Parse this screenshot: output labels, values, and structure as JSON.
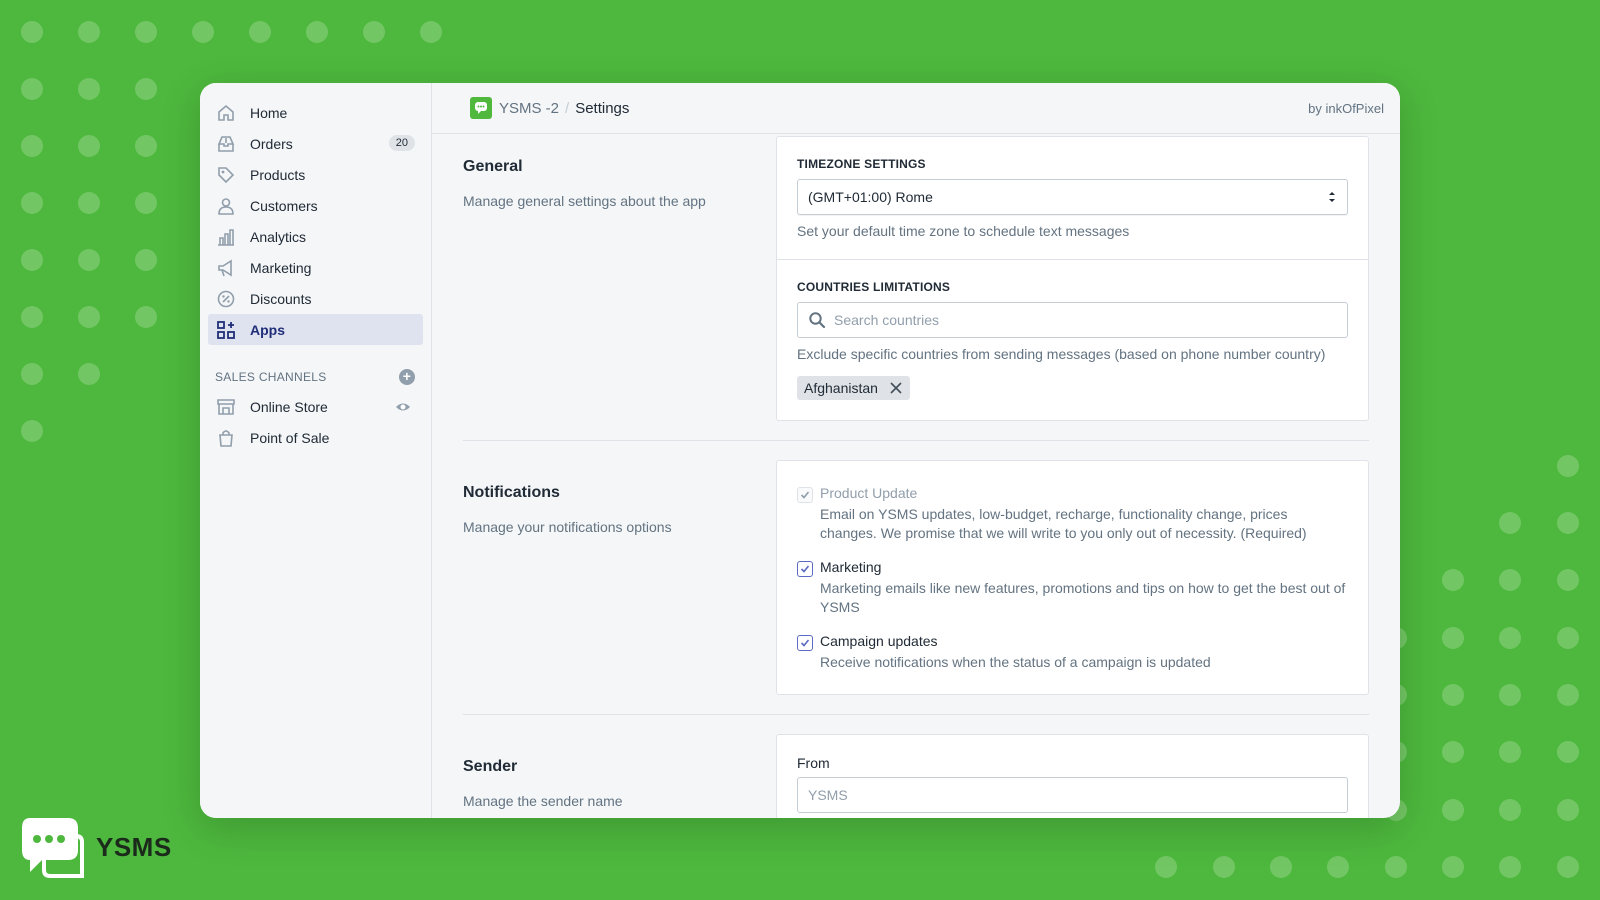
{
  "colors": {
    "background": "#4db83d",
    "accent": "#5c6ac4",
    "brand": "#50b83c"
  },
  "sidebar": {
    "items": [
      {
        "label": "Home",
        "icon": "home-icon"
      },
      {
        "label": "Orders",
        "icon": "orders-icon",
        "badge": "20"
      },
      {
        "label": "Products",
        "icon": "tag-icon"
      },
      {
        "label": "Customers",
        "icon": "person-icon"
      },
      {
        "label": "Analytics",
        "icon": "bar-chart-icon"
      },
      {
        "label": "Marketing",
        "icon": "megaphone-icon"
      },
      {
        "label": "Discounts",
        "icon": "discount-icon"
      },
      {
        "label": "Apps",
        "icon": "apps-icon",
        "active": true
      }
    ],
    "sales_channels": {
      "header": "SALES CHANNELS",
      "items": [
        {
          "label": "Online Store",
          "icon": "store-icon"
        },
        {
          "label": "Point of Sale",
          "icon": "shopping-bag-icon"
        }
      ]
    }
  },
  "topbar": {
    "app_name": "YSMS -2",
    "separator": "/",
    "page": "Settings",
    "byline": "by inkOfPixel"
  },
  "sections": {
    "general": {
      "title": "General",
      "description": "Manage general settings about the app",
      "timezone": {
        "caption": "TIMEZONE SETTINGS",
        "value": "(GMT+01:00) Rome",
        "help": "Set your default time zone to schedule text messages"
      },
      "countries": {
        "caption": "COUNTRIES LIMITATIONS",
        "placeholder": "Search countries",
        "help": "Exclude specific countries from sending messages (based on phone number country)",
        "tags": [
          "Afghanistan"
        ]
      }
    },
    "notifications": {
      "title": "Notifications",
      "description": "Manage your notifications options",
      "options": [
        {
          "label": "Product Update",
          "help": "Email on YSMS updates, low-budget, recharge, functionality change, prices changes. We promise that we will write to you only out of necessity. (Required)",
          "checked": true,
          "disabled": true
        },
        {
          "label": "Marketing",
          "help": "Marketing emails like new features, promotions and tips on how to get the best out of YSMS",
          "checked": true,
          "disabled": false
        },
        {
          "label": "Campaign updates",
          "help": "Receive notifications when the status of a campaign is updated",
          "checked": true,
          "disabled": false
        }
      ]
    },
    "sender": {
      "title": "Sender",
      "description": "Manage the sender name",
      "from_label": "From",
      "from_value": "YSMS"
    }
  },
  "brand": {
    "name": "YSMS"
  }
}
